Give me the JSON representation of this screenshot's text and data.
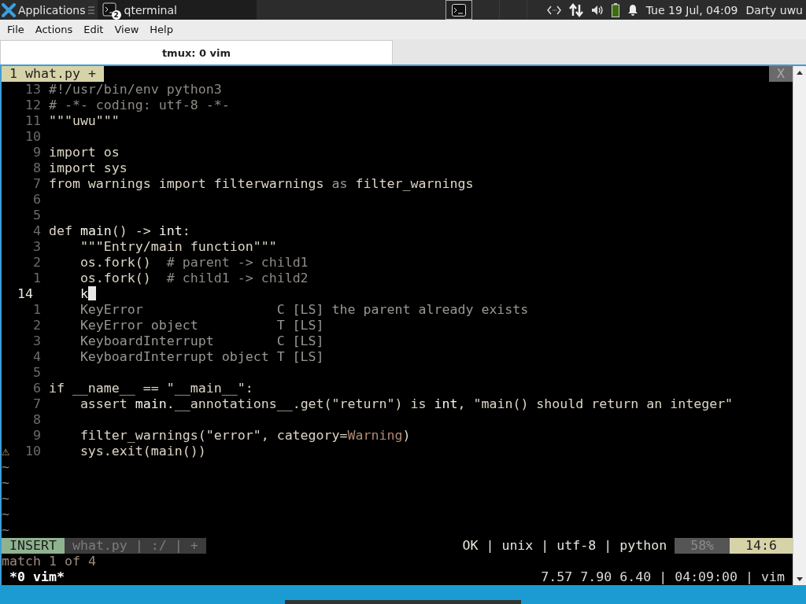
{
  "panel": {
    "app_menu": "Applications",
    "tasks": [
      {
        "label": "qterminal",
        "badge": "2",
        "selected": true
      }
    ],
    "clock": "Tue 19 Jul, 04:09",
    "user": "Darty uwu"
  },
  "window": {
    "menu": [
      "File",
      "Actions",
      "Edit",
      "View",
      "Help"
    ],
    "tabs": [
      {
        "label": "tmux: 0 vim",
        "selected": true
      }
    ]
  },
  "vim": {
    "tabs": [
      {
        "label": "1 what.py +",
        "selected": true
      }
    ],
    "close": "X",
    "lines": [
      {
        "number": "13",
        "tokens": [
          {
            "text": "#!/usr/bin/env python3",
            "kind": "comment"
          }
        ]
      },
      {
        "number": "12",
        "tokens": [
          {
            "text": "# -*- coding: utf-8 -*-",
            "kind": "comment"
          }
        ]
      },
      {
        "number": "11",
        "tokens": [
          {
            "text": "\"\"\"uwu\"\"\"",
            "kind": "code"
          }
        ]
      },
      {
        "number": "10"
      },
      {
        "number": "9",
        "tokens": [
          {
            "text": "import os",
            "kind": "code"
          }
        ]
      },
      {
        "number": "8",
        "tokens": [
          {
            "text": "import sys",
            "kind": "code"
          }
        ]
      },
      {
        "number": "7",
        "tokens": [
          {
            "text": "from warnings import filterwarnings ",
            "kind": "code"
          },
          {
            "text": "as",
            "kind": "muted"
          },
          {
            "text": " filter_warnings",
            "kind": "code"
          }
        ]
      },
      {
        "number": "6"
      },
      {
        "number": "5"
      },
      {
        "number": "4",
        "tokens": [
          {
            "text": "def ",
            "kind": "code"
          },
          {
            "text": "main",
            "kind": "bright"
          },
          {
            "text": "() -> ",
            "kind": "code"
          },
          {
            "text": "int",
            "kind": "bright"
          },
          {
            "text": ":",
            "kind": "code"
          }
        ]
      },
      {
        "number": "3",
        "tokens": [
          {
            "text": "    \"\"\"Entry/main function\"\"\"",
            "kind": "code"
          }
        ]
      },
      {
        "number": "2",
        "tokens": [
          {
            "text": "    os.fork()  ",
            "kind": "code"
          },
          {
            "text": "# parent -> child1",
            "kind": "comment"
          }
        ]
      },
      {
        "number": "1",
        "tokens": [
          {
            "text": "    os.fork()  ",
            "kind": "code"
          },
          {
            "text": "# child1 -> child2",
            "kind": "comment"
          }
        ]
      },
      {
        "number": "14",
        "current": true,
        "cursor": true,
        "tokens": [
          {
            "text": "    k",
            "kind": "bright"
          }
        ]
      },
      {
        "number": "1",
        "tokens": [
          {
            "text": "    KeyError                 C [LS] the parent already exists",
            "kind": "muted"
          }
        ]
      },
      {
        "number": "2",
        "tokens": [
          {
            "text": "    KeyError object          T [LS]",
            "kind": "muted"
          }
        ]
      },
      {
        "number": "3",
        "tokens": [
          {
            "text": "    KeyboardInterrupt        C [LS]",
            "kind": "muted"
          }
        ]
      },
      {
        "number": "4",
        "tokens": [
          {
            "text": "    KeyboardInterrupt object T [LS]",
            "kind": "muted"
          }
        ]
      },
      {
        "number": "5"
      },
      {
        "number": "6",
        "tokens": [
          {
            "text": "if __name__ == \"__main__\":",
            "kind": "code"
          }
        ]
      },
      {
        "number": "7",
        "tokens": [
          {
            "text": "    assert ",
            "kind": "code"
          },
          {
            "text": "main",
            "kind": "bright"
          },
          {
            "text": ".__annotations__.get(\"return\") is ",
            "kind": "code"
          },
          {
            "text": "int",
            "kind": "bright"
          },
          {
            "text": ", \"main() should return an integer\"",
            "kind": "code"
          }
        ]
      },
      {
        "number": "8"
      },
      {
        "number": "9",
        "tokens": [
          {
            "text": "    filter_warnings(\"error\", category=",
            "kind": "code"
          },
          {
            "text": "Warning",
            "kind": "accent"
          },
          {
            "text": ")",
            "kind": "code"
          }
        ]
      },
      {
        "number": "10",
        "sign": "⚠",
        "tokens": [
          {
            "text": "    sys.exit(main())",
            "kind": "code"
          }
        ]
      }
    ],
    "fillers": [
      "~",
      "~",
      "~",
      "~",
      "~"
    ],
    "status": {
      "mode": "INSERT",
      "file": "what.py | :/ | +",
      "info": "OK | unix | utf-8 | python",
      "percent": "58%",
      "position": "14:6"
    },
    "message": "match 1 of 4"
  },
  "tmux": {
    "window": "*0 vim*",
    "right": "7.57 7.90 6.40 | 04:09:00 | vim"
  }
}
